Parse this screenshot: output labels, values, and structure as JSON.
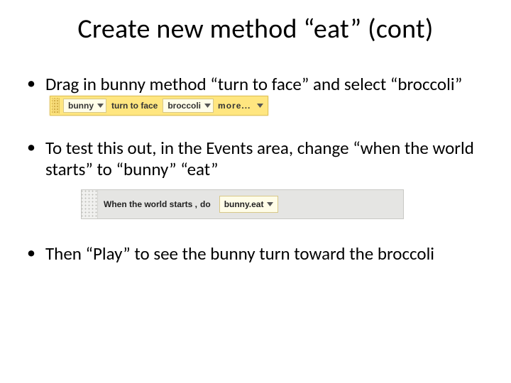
{
  "title": "Create new method “eat” (cont)",
  "bullets": {
    "b1": "Drag in bunny method “turn to face” and select “broccoli”",
    "b2": "To test this out, in the Events area, change “when the world starts” to “bunny” “eat”",
    "b3": "Then “Play” to see the bunny turn toward the broccoli"
  },
  "tile_strip": {
    "object": "bunny",
    "action": "turn to face",
    "target": "broccoli",
    "more": "more..."
  },
  "event_strip": {
    "when": "When the world starts ,",
    "do": "do",
    "call": "bunny.eat"
  }
}
